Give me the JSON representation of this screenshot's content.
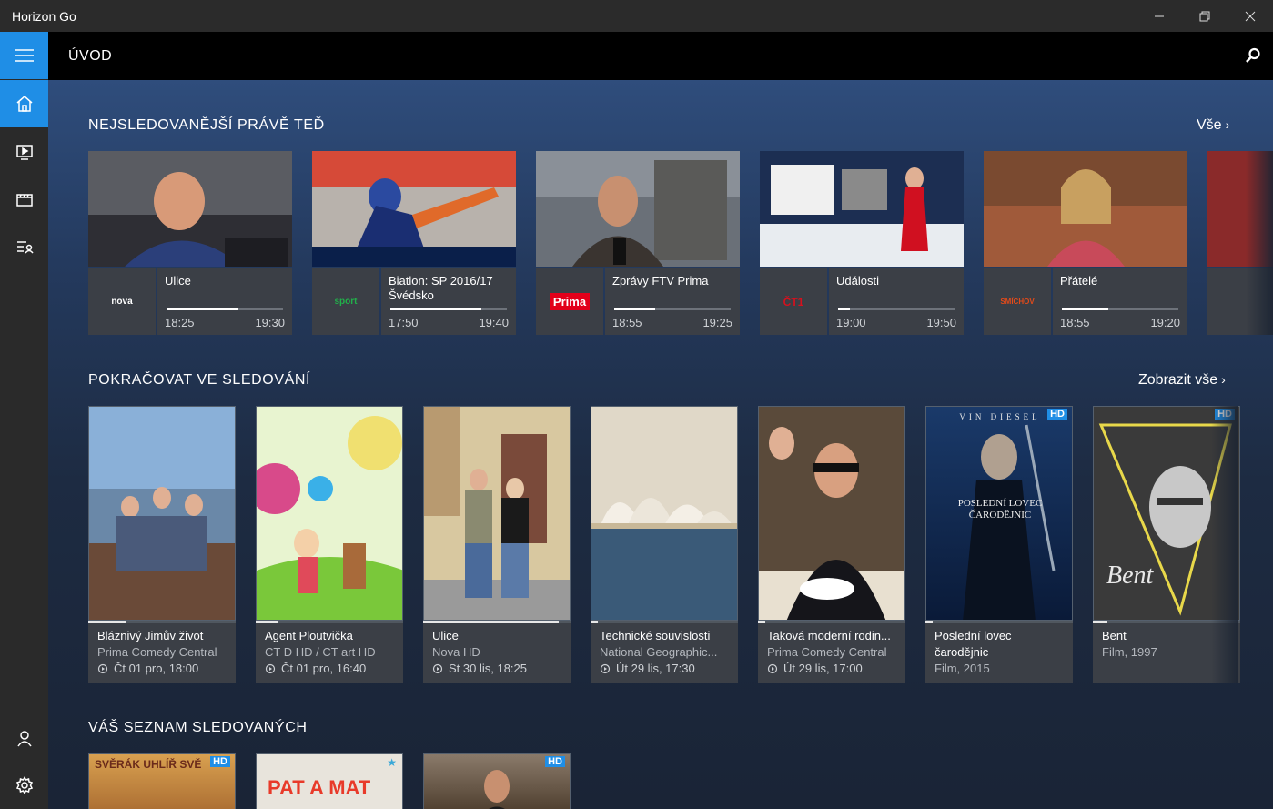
{
  "window": {
    "title": "Horizon Go"
  },
  "header": {
    "page_title": "ÚVOD"
  },
  "sections": {
    "most_watched": {
      "title": "NEJSLEDOVANĚJŠÍ PRÁVĚ TEĎ",
      "see_all": "Vše"
    },
    "continue": {
      "title": "POKRAČOVAT VE SLEDOVÁNÍ",
      "see_all": "Zobrazit vše"
    },
    "watchlist": {
      "title": "VÁŠ SEZNAM SLEDOVANÝCH"
    }
  },
  "live": [
    {
      "channel": "nova",
      "logo_color": "#ffffff",
      "title": "Ulice",
      "start": "18:25",
      "end": "19:30",
      "progress": 0.62
    },
    {
      "channel": "sport",
      "logo_color": "#21b14a",
      "title": "Biatlon: SP 2016/17 Švédsko",
      "start": "17:50",
      "end": "19:40",
      "progress": 0.78
    },
    {
      "channel": "Prima",
      "logo_color": "#e2001a",
      "title": "Zprávy FTV Prima",
      "start": "18:55",
      "end": "19:25",
      "progress": 0.35
    },
    {
      "channel": "ČT1",
      "logo_color": "#d4111e",
      "title": "Události",
      "start": "19:00",
      "end": "19:50",
      "progress": 0.1
    },
    {
      "channel": "SMÍCHOV",
      "logo_color": "#e24a1a",
      "title": "Přátelé",
      "start": "18:55",
      "end": "19:20",
      "progress": 0.4
    }
  ],
  "continue_items": [
    {
      "title": "Bláznivý Jimův život",
      "sub": "Prima Comedy Central",
      "time": "Čt 01 pro, 18:00",
      "progress": 0.25,
      "has_time": true
    },
    {
      "title": "Agent Ploutvička",
      "sub": "CT D HD / CT art HD",
      "time": "Čt 01 pro, 16:40",
      "progress": 0.15,
      "has_time": true
    },
    {
      "title": "Ulice",
      "sub": "Nova HD",
      "time": "St 30 lis, 18:25",
      "progress": 0.92,
      "has_time": true
    },
    {
      "title": "Technické souvislosti",
      "sub": "National Geographic...",
      "time": "Út 29 lis, 17:30",
      "progress": 0.05,
      "has_time": true
    },
    {
      "title": "Taková moderní rodin...",
      "sub": "Prima Comedy Central",
      "time": "Út 29 lis, 17:00",
      "progress": 0.05,
      "has_time": true
    },
    {
      "title": "Poslední lovec",
      "title2": "čarodějnic",
      "sub": "Film, 2015",
      "progress": 0.05,
      "has_time": false,
      "hd": "HD",
      "poster_text": "VIN DIESEL",
      "poster_text2": "POSLEDNÍ LOVEC ČARODĚJNIC"
    },
    {
      "title": "Bent",
      "sub": "Film, 1997",
      "progress": 0.1,
      "has_time": false,
      "hd": "HD",
      "poster_text": "Bent"
    }
  ],
  "watchlist_items": [
    {
      "text": "SVĚRÁK  UHLÍŘ  SVĚ",
      "hd": "HD"
    },
    {
      "text": "PAT A MAT",
      "hd": ""
    },
    {
      "text": "",
      "hd": "HD"
    }
  ],
  "colors": {
    "accent": "#1f8ee6",
    "card_bg": "#3b3f46"
  }
}
